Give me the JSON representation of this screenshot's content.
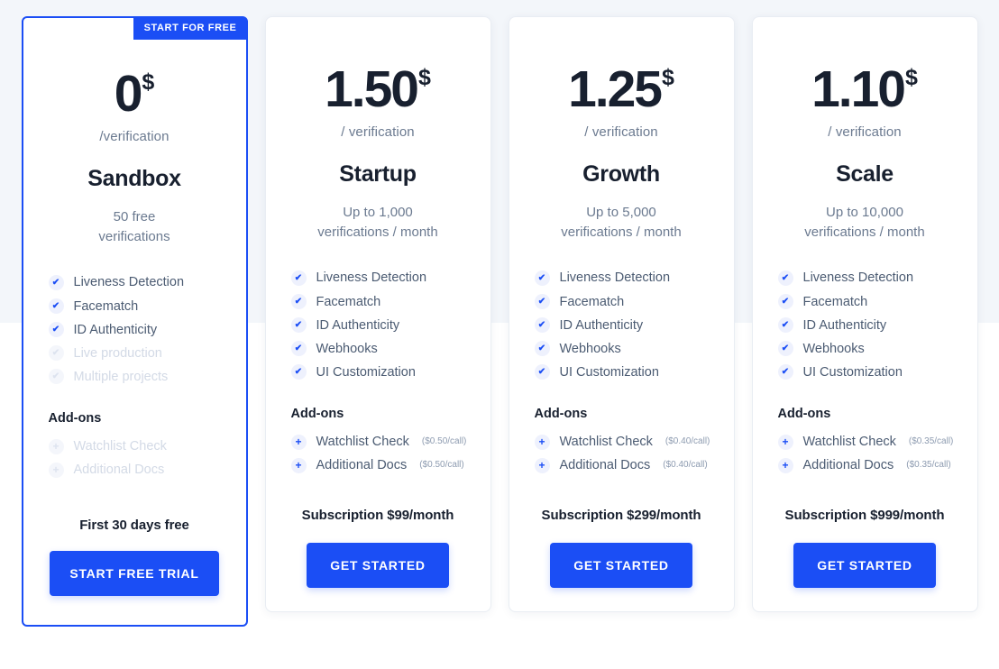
{
  "page": {
    "background_top": "#f3f6fa",
    "background_bottom": "#ffffff",
    "accent_color": "#1b4ef5",
    "heading_color": "#18202f",
    "muted_color": "#6b7a90"
  },
  "plans": [
    {
      "id": "sandbox",
      "featured": true,
      "badge": "START FOR FREE",
      "price": "0",
      "currency": "$",
      "per": "/verification",
      "name": "Sandbox",
      "quota_line1": "50 free",
      "quota_line2": "verifications",
      "features": [
        {
          "label": "Liveness Detection",
          "enabled": true,
          "icon": "check-icon"
        },
        {
          "label": "Facematch",
          "enabled": true,
          "icon": "check-icon"
        },
        {
          "label": "ID Authenticity",
          "enabled": true,
          "icon": "check-icon"
        },
        {
          "label": "Live production",
          "enabled": false,
          "icon": "check-icon"
        },
        {
          "label": "Multiple projects",
          "enabled": false,
          "icon": "check-icon"
        }
      ],
      "addons_title": "Add-ons",
      "addons": [
        {
          "label": "Watchlist Check",
          "cost": "",
          "enabled": false,
          "icon": "plus-icon"
        },
        {
          "label": "Additional Docs",
          "cost": "",
          "enabled": false,
          "icon": "plus-icon"
        }
      ],
      "subscription": "First 30 days free",
      "cta": "START FREE TRIAL"
    },
    {
      "id": "startup",
      "featured": false,
      "badge": "",
      "price": "1.50",
      "currency": "$",
      "per": "/ verification",
      "name": "Startup",
      "quota_line1": "Up to 1,000",
      "quota_line2": "verifications / month",
      "features": [
        {
          "label": "Liveness Detection",
          "enabled": true,
          "icon": "check-icon"
        },
        {
          "label": "Facematch",
          "enabled": true,
          "icon": "check-icon"
        },
        {
          "label": "ID Authenticity",
          "enabled": true,
          "icon": "check-icon"
        },
        {
          "label": "Webhooks",
          "enabled": true,
          "icon": "check-icon"
        },
        {
          "label": "UI Customization",
          "enabled": true,
          "icon": "check-icon"
        }
      ],
      "addons_title": "Add-ons",
      "addons": [
        {
          "label": "Watchlist Check",
          "cost": "($0.50/call)",
          "enabled": true,
          "icon": "plus-icon"
        },
        {
          "label": "Additional Docs",
          "cost": "($0.50/call)",
          "enabled": true,
          "icon": "plus-icon"
        }
      ],
      "subscription": "Subscription $99/month",
      "cta": "GET STARTED"
    },
    {
      "id": "growth",
      "featured": false,
      "badge": "",
      "price": "1.25",
      "currency": "$",
      "per": "/ verification",
      "name": "Growth",
      "quota_line1": "Up to 5,000",
      "quota_line2": "verifications / month",
      "features": [
        {
          "label": "Liveness Detection",
          "enabled": true,
          "icon": "check-icon"
        },
        {
          "label": "Facematch",
          "enabled": true,
          "icon": "check-icon"
        },
        {
          "label": "ID Authenticity",
          "enabled": true,
          "icon": "check-icon"
        },
        {
          "label": "Webhooks",
          "enabled": true,
          "icon": "check-icon"
        },
        {
          "label": "UI Customization",
          "enabled": true,
          "icon": "check-icon"
        }
      ],
      "addons_title": "Add-ons",
      "addons": [
        {
          "label": "Watchlist Check",
          "cost": "($0.40/call)",
          "enabled": true,
          "icon": "plus-icon"
        },
        {
          "label": "Additional Docs",
          "cost": "($0.40/call)",
          "enabled": true,
          "icon": "plus-icon"
        }
      ],
      "subscription": "Subscription $299/month",
      "cta": "GET STARTED"
    },
    {
      "id": "scale",
      "featured": false,
      "badge": "",
      "price": "1.10",
      "currency": "$",
      "per": "/ verification",
      "name": "Scale",
      "quota_line1": "Up to 10,000",
      "quota_line2": "verifications / month",
      "features": [
        {
          "label": "Liveness Detection",
          "enabled": true,
          "icon": "check-icon"
        },
        {
          "label": "Facematch",
          "enabled": true,
          "icon": "check-icon"
        },
        {
          "label": "ID Authenticity",
          "enabled": true,
          "icon": "check-icon"
        },
        {
          "label": "Webhooks",
          "enabled": true,
          "icon": "check-icon"
        },
        {
          "label": "UI Customization",
          "enabled": true,
          "icon": "check-icon"
        }
      ],
      "addons_title": "Add-ons",
      "addons": [
        {
          "label": "Watchlist Check",
          "cost": "($0.35/call)",
          "enabled": true,
          "icon": "plus-icon"
        },
        {
          "label": "Additional Docs",
          "cost": "($0.35/call)",
          "enabled": true,
          "icon": "plus-icon"
        }
      ],
      "subscription": "Subscription $999/month",
      "cta": "GET STARTED"
    }
  ],
  "glyphs": {
    "check": "✔",
    "plus": "+"
  }
}
